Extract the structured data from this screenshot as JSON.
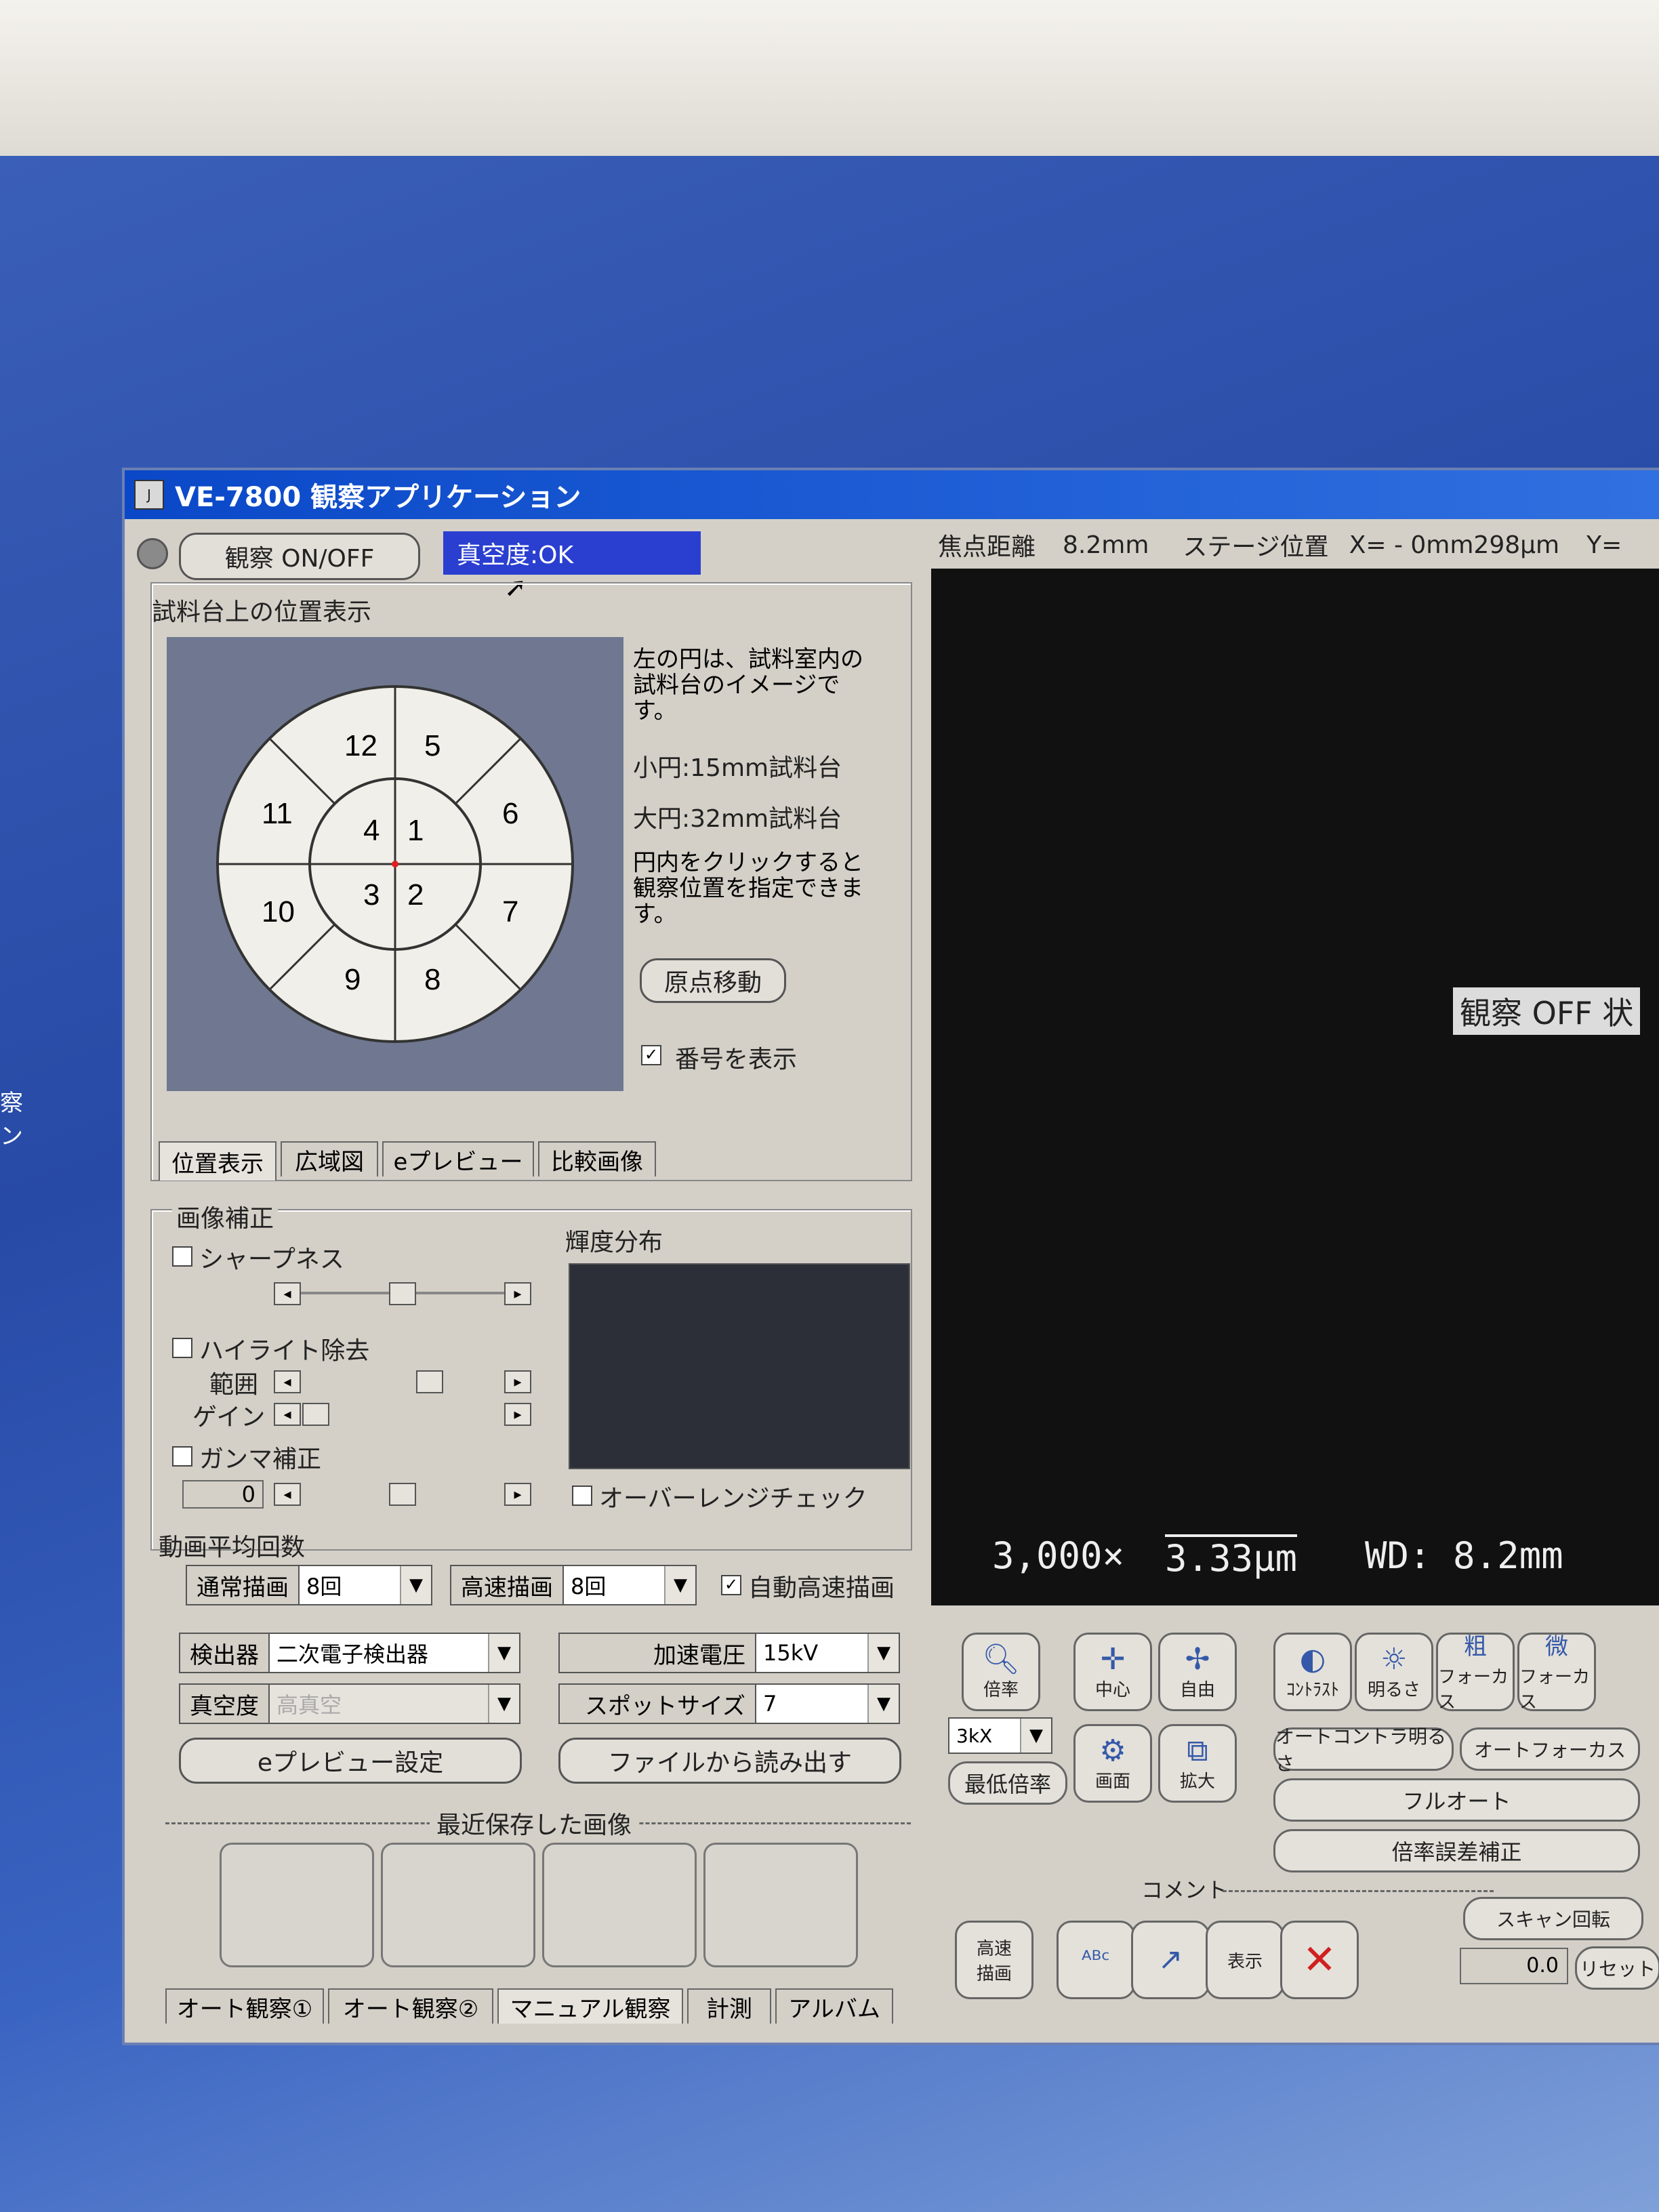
{
  "desktop_label": "察ン",
  "window": {
    "title": "VE-7800 観察アプリケーション"
  },
  "top": {
    "observe_button": "観察 ON/OFF",
    "vacuum_status": "真空度:OK"
  },
  "status": {
    "focal_label": "焦点距離",
    "focal_value": "8.2mm",
    "stage_label": "ステージ位置",
    "stage_x": "X= - 0mm298μm",
    "stage_y": "Y="
  },
  "position_panel": {
    "title": "試料台上の位置表示",
    "description": "左の円は、試料室内の試料台のイメージです。",
    "small_circle": "小円:15mm試料台",
    "large_circle": "大円:32mm試料台",
    "click_hint": "円内をクリックすると観察位置を指定できます。",
    "origin_button": "原点移動",
    "show_numbers": "番号を表示",
    "numbers": {
      "n1": "1",
      "n2": "2",
      "n3": "3",
      "n4": "4",
      "n5": "5",
      "n6": "6",
      "n7": "7",
      "n8": "8",
      "n9": "9",
      "n10": "10",
      "n11": "11",
      "n12": "12"
    }
  },
  "view_tabs": [
    "位置表示",
    "広域図",
    "eプレビュー",
    "比較画像"
  ],
  "image_correction": {
    "title": "画像補正",
    "sharpness": "シャープネス",
    "highlight": "ハイライト除去",
    "range": "範囲",
    "gain": "ゲイン",
    "gamma": "ガンマ補正",
    "gamma_value": "0",
    "histogram_title": "輝度分布",
    "overrange": "オーバーレンジチェック"
  },
  "averaging": {
    "title": "動画平均回数",
    "normal_label": "通常描画",
    "normal_value": "8回",
    "fast_label": "高速描画",
    "fast_value": "8回",
    "auto_fast": "自動高速描画"
  },
  "settings": {
    "detector_label": "検出器",
    "detector_value": "二次電子検出器",
    "accel_label": "加速電圧",
    "accel_value": "15kV",
    "vacuum_label": "真空度",
    "vacuum_value": "高真空",
    "spot_label": "スポットサイズ",
    "spot_value": "7",
    "eprev_button": "eプレビュー設定",
    "load_button": "ファイルから読み出す"
  },
  "recent": {
    "title": "最近保存した画像"
  },
  "bottom_tabs": [
    "オート観察①",
    "オート観察②",
    "マニュアル観察",
    "計測",
    "アルバム"
  ],
  "viewer": {
    "observe_off": "観察 OFF 状",
    "magnification": "3,000×",
    "scale": "3.33μm",
    "wd": "WD: 8.2mm"
  },
  "controls": {
    "mag": "倍率",
    "center": "中心",
    "free": "自由",
    "contrast": "ｺﾝﾄﾗｽﾄ",
    "brightness": "明るさ",
    "coarse_focus": "フォーカス",
    "fine_focus": "フォーカス",
    "coarse": "粗",
    "fine": "微",
    "mag_select": "3kX",
    "min_mag": "最低倍率",
    "screen": "画面",
    "enlarge": "拡大",
    "auto_contrast": "オートコントラ明るさ",
    "auto_focus": "オートフォーカス",
    "full_auto": "フルオート",
    "mag_error": "倍率誤差補正",
    "comment": "コメント",
    "fast_draw": "高速描画",
    "display": "表示",
    "scan_rotate": "スキャン回転",
    "rotate_value": "0.0",
    "reset": "リセット"
  }
}
